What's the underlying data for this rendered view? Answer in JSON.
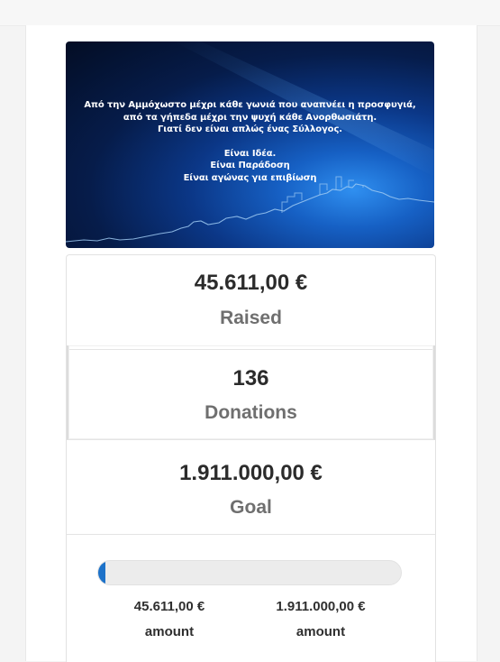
{
  "banner": {
    "lines": [
      "Από την Αμμόχωστο μέχρι κάθε γωνιά που αναπνέει η προσφυγιά,",
      "από τα γήπεδα μέχρι την ψυχή κάθε Ανορθωσιάτη.",
      "Γιατί δεν είναι απλώς ένας Σύλλογος."
    ],
    "lines2": [
      "Είναι Ιδέα.",
      "Είναι Παράδοση",
      "Είναι αγώνας για επιβίωση"
    ]
  },
  "stats": {
    "raised": {
      "value": "45.611,00 €",
      "label": "Raised"
    },
    "donations": {
      "value": "136",
      "label": "Donations"
    },
    "goal": {
      "value": "1.911.000,00 €",
      "label": "Goal"
    }
  },
  "progress": {
    "fraction": 0.0239,
    "color": "#1d72c9",
    "current": {
      "value": "45.611,00 €",
      "label": "amount"
    },
    "target": {
      "value": "1.911.000,00 €",
      "label": "amount"
    }
  }
}
